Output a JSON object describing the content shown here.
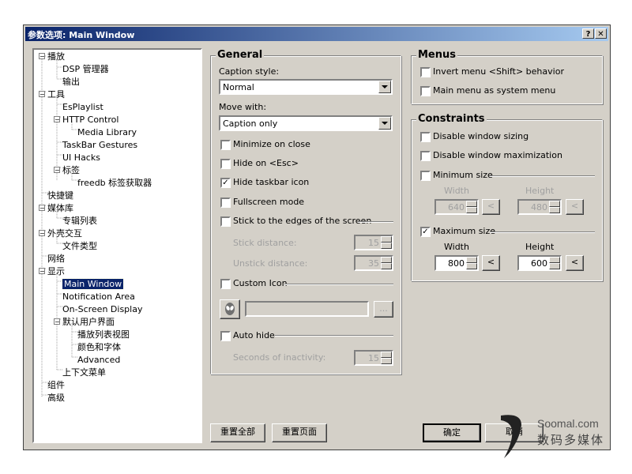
{
  "window": {
    "title": "参数选项: Main Window",
    "help_label": "?",
    "close_label": "✕"
  },
  "tree": {
    "items": [
      {
        "label": "播放",
        "expander": "−"
      },
      {
        "label": "DSP 管理器"
      },
      {
        "label": "输出"
      },
      {
        "label": "工具",
        "expander": "−"
      },
      {
        "label": "EsPlaylist"
      },
      {
        "label": "HTTP Control",
        "expander": "−"
      },
      {
        "label": "Media Library"
      },
      {
        "label": "TaskBar Gestures"
      },
      {
        "label": "UI Hacks"
      },
      {
        "label": "标签",
        "expander": "−"
      },
      {
        "label": "freedb 标签获取器"
      },
      {
        "label": "快捷键"
      },
      {
        "label": "媒体库",
        "expander": "−"
      },
      {
        "label": "专辑列表"
      },
      {
        "label": "外壳交互",
        "expander": "−"
      },
      {
        "label": "文件类型"
      },
      {
        "label": "网络"
      },
      {
        "label": "显示",
        "expander": "−"
      },
      {
        "label": "Main Window",
        "selected": true
      },
      {
        "label": "Notification Area"
      },
      {
        "label": "On-Screen Display"
      },
      {
        "label": "默认用户界面",
        "expander": "−"
      },
      {
        "label": "播放列表视图"
      },
      {
        "label": "颜色和字体"
      },
      {
        "label": "Advanced"
      },
      {
        "label": "上下文菜单"
      },
      {
        "label": "组件"
      },
      {
        "label": "高级"
      }
    ]
  },
  "general": {
    "title": "General",
    "caption_style_label": "Caption style:",
    "caption_style_value": "Normal",
    "move_with_label": "Move with:",
    "move_with_value": "Caption only",
    "minimize_on_close": "Minimize on close",
    "hide_on_esc": "Hide on <Esc>",
    "hide_taskbar_icon": "Hide taskbar icon",
    "fullscreen_mode": "Fullscreen mode",
    "stick_edges": "Stick to the edges of the screen",
    "stick_distance_label": "Stick distance:",
    "stick_distance_value": "15",
    "unstick_distance_label": "Unstick distance:",
    "unstick_distance_value": "35",
    "custom_icon": "Custom Icon",
    "browse_label": "...",
    "auto_hide": "Auto hide",
    "seconds_inactivity_label": "Seconds of inactivity:",
    "seconds_inactivity_value": "15"
  },
  "menus": {
    "title": "Menus",
    "invert_shift": "Invert menu <Shift> behavior",
    "main_menu_system": "Main menu as system menu"
  },
  "constraints": {
    "title": "Constraints",
    "disable_sizing": "Disable window sizing",
    "disable_maximization": "Disable window maximization",
    "minimum_size": "Minimum size",
    "min_width_label": "Width",
    "min_height_label": "Height",
    "min_width_value": "640",
    "min_height_value": "480",
    "maximum_size": "Maximum size",
    "max_width_label": "Width",
    "max_height_label": "Height",
    "max_width_value": "800",
    "max_height_value": "600",
    "pick_label": "<"
  },
  "buttons": {
    "reset_all": "重置全部",
    "reset_page": "重置页面",
    "ok": "确定",
    "cancel": "取消"
  },
  "watermark": {
    "brand": "Soomal.com",
    "tagline": "数码多媒体"
  }
}
